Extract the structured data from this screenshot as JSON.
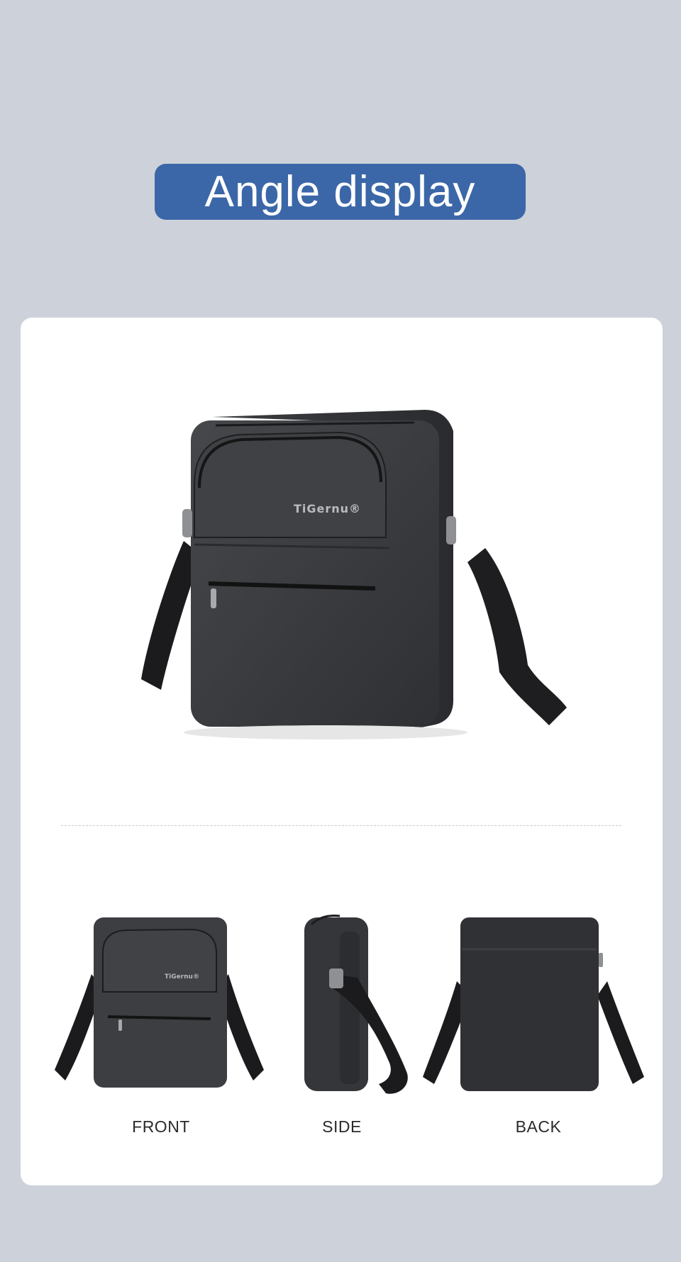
{
  "header": {
    "title": "Angle display"
  },
  "hero": {
    "logo_text": "TiGernu®"
  },
  "views": [
    {
      "label": "FRONT",
      "logo_text": "TiGernu®"
    },
    {
      "label": "SIDE"
    },
    {
      "label": "BACK"
    }
  ],
  "colors": {
    "background": "#cdd1d9",
    "title_pill": "#3b67a8",
    "card": "#ffffff",
    "bag": "#3a3b3e",
    "strap": "#1c1c1e"
  },
  "icons": [
    "bag-hero-image",
    "bag-front-image",
    "bag-side-image",
    "bag-back-image"
  ]
}
